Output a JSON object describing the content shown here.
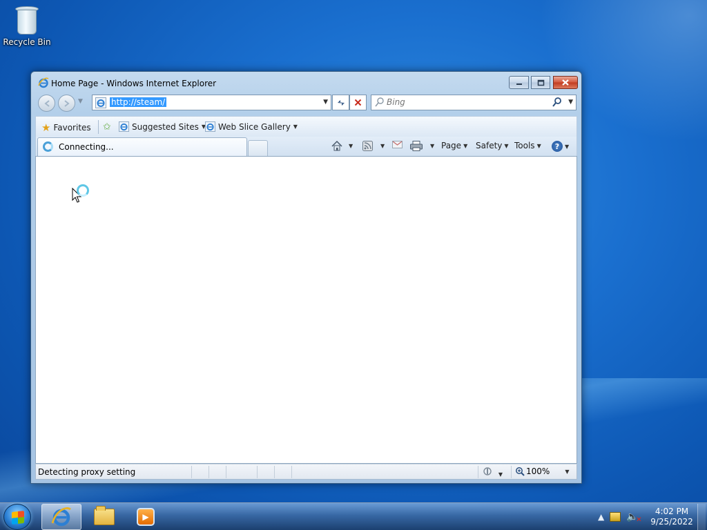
{
  "desktop": {
    "icons": [
      {
        "label": "Recycle Bin",
        "icon": "recycle-bin-icon"
      }
    ]
  },
  "window": {
    "title": "Home Page - Windows Internet Explorer",
    "controls": {
      "minimize": "minimize",
      "maximize": "maximize",
      "close": "close"
    }
  },
  "address_bar": {
    "url": "http://steam/",
    "search_placeholder": "Bing"
  },
  "favorites_bar": {
    "favorites_label": "Favorites",
    "items": [
      {
        "label": "Suggested Sites"
      },
      {
        "label": "Web Slice Gallery"
      }
    ]
  },
  "tabs": [
    {
      "label": "Connecting...",
      "active": true
    }
  ],
  "command_bar": {
    "page_label": "Page",
    "safety_label": "Safety",
    "tools_label": "Tools"
  },
  "status_bar": {
    "text": "Detecting proxy setting",
    "zoom": "100%"
  },
  "taskbar": {
    "pinned": [
      {
        "name": "Internet Explorer",
        "icon": "internet-explorer-icon",
        "active": true
      },
      {
        "name": "Windows Explorer",
        "icon": "folder-icon",
        "active": false
      },
      {
        "name": "Windows Media Player",
        "icon": "media-player-icon",
        "active": false
      }
    ],
    "clock_time": "4:02 PM",
    "clock_date": "9/25/2022"
  },
  "colors": {
    "selection": "#3399ff",
    "close_button": "#c13a1f",
    "desktop_blue": "#1a6fcf"
  }
}
